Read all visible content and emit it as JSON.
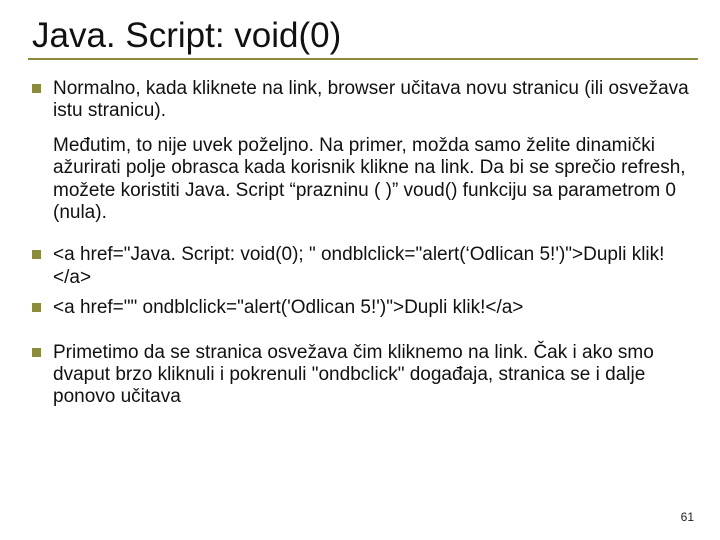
{
  "title": "Java. Script: void(0)",
  "bullets": {
    "b1": "Normalno, kada kliknete na link, browser učitava novu stranicu (ili osvežava istu stranicu).",
    "para": "Međutim, to nije uvek poželjno. Na primer, možda samo želite dinamički ažurirati polje obrasca kada korisnik klikne na link. Da bi se sprečio refresh, možete koristiti Java. Script “prazninu ( )” voud() funkciju sa parametrom 0 (nula).",
    "b2": "<a href=\"Java. Script: void(0); \" ondblclick=\"alert(‘Odlican 5!')\">Dupli klik!</a>",
    "b3": "<a href=\"\" ondblclick=\"alert('Odlican 5!')\">Dupli klik!</a>",
    "b4": "Primetimo da se stranica osvežava čim kliknemo na link. Čak i ako smo dvaput brzo kliknuli i pokrenuli \"ondbclick\" događaja, stranica se i dalje ponovo učitava"
  },
  "page_number": "61",
  "colors": {
    "accent": "#8b8b3c"
  }
}
